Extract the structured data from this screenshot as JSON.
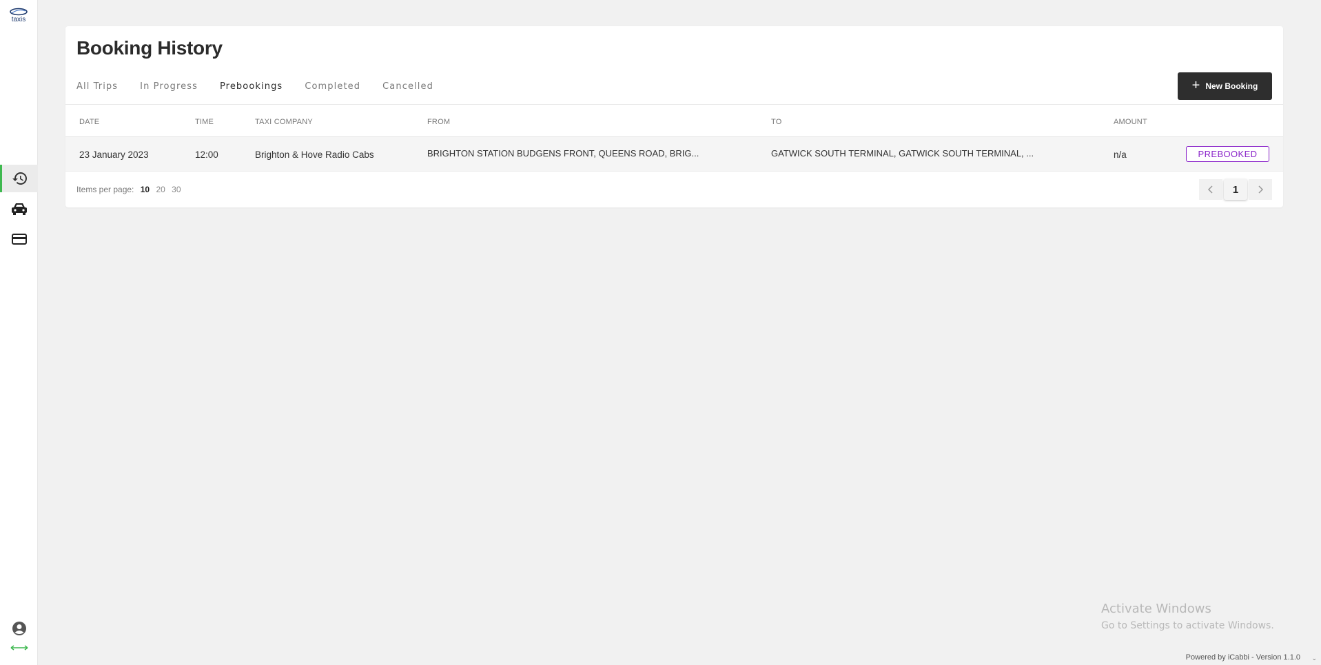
{
  "app": {
    "logo_text": "taxis"
  },
  "sidebar": {
    "items": [
      {
        "name": "history",
        "icon": "history-icon",
        "active": true
      },
      {
        "name": "book-taxi",
        "icon": "taxi-icon",
        "active": false
      },
      {
        "name": "payment",
        "icon": "credit-card-icon",
        "active": false
      }
    ],
    "accent_color": "#3fb950"
  },
  "page": {
    "title": "Booking History"
  },
  "tabs": [
    {
      "label": "All Trips",
      "active": false
    },
    {
      "label": "In Progress",
      "active": false
    },
    {
      "label": "Prebookings",
      "active": true
    },
    {
      "label": "Completed",
      "active": false
    },
    {
      "label": "Cancelled",
      "active": false
    }
  ],
  "new_booking": {
    "label": "New Booking"
  },
  "table": {
    "headers": {
      "date": "DATE",
      "time": "TIME",
      "company": "TAXI COMPANY",
      "from": "FROM",
      "to": "TO",
      "amount": "AMOUNT"
    },
    "rows": [
      {
        "date": "23 January 2023",
        "time": "12:00",
        "company": "Brighton & Hove Radio Cabs",
        "from": "BRIGHTON STATION BUDGENS FRONT, QUEENS ROAD, BRIG...",
        "to": "GATWICK SOUTH TERMINAL, GATWICK SOUTH TERMINAL, ...",
        "amount": "n/a",
        "status": "PREBOOKED"
      }
    ]
  },
  "pagination": {
    "items_per_page_label": "Items per page:",
    "options": [
      "10",
      "20",
      "30"
    ],
    "selected": "10",
    "current_page": "1"
  },
  "watermark": {
    "title": "Activate Windows",
    "subtitle": "Go to Settings to activate Windows."
  },
  "footer": {
    "powered_by": "Powered by iCabbi - Version 1.1.0"
  },
  "colors": {
    "status_prebooked": "#8a24c9",
    "button_dark": "#2e2e2e"
  }
}
